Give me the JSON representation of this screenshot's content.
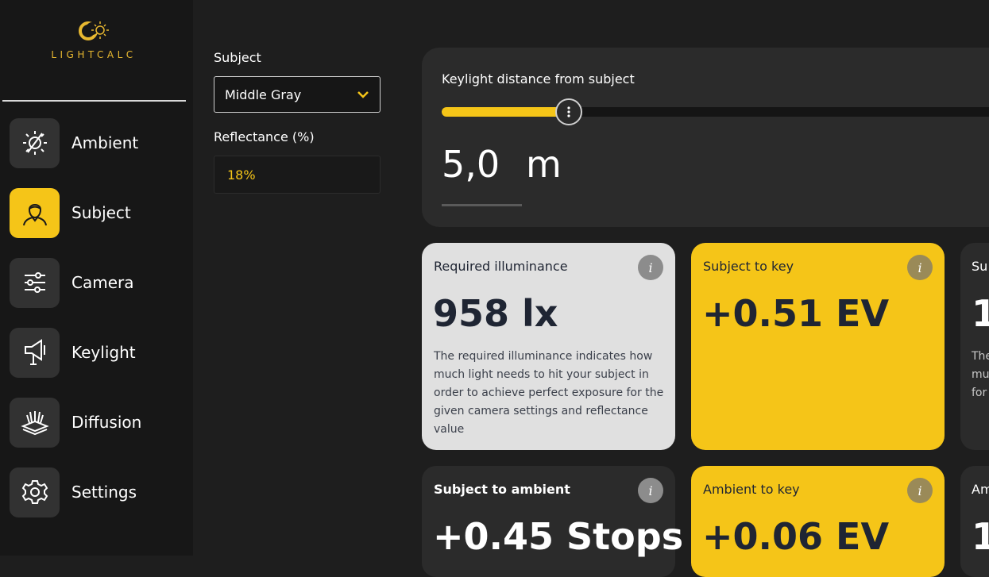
{
  "app": {
    "logo_text": "LIGHTCALC",
    "accent_color": "#f5c518"
  },
  "sidebar": {
    "items": [
      {
        "label": "Ambient",
        "icon": "ambient-sun-slash-icon",
        "active": false
      },
      {
        "label": "Subject",
        "icon": "person-icon",
        "active": true
      },
      {
        "label": "Camera",
        "icon": "sliders-icon",
        "active": false
      },
      {
        "label": "Keylight",
        "icon": "spotlight-icon",
        "active": false
      },
      {
        "label": "Diffusion",
        "icon": "diffusion-icon",
        "active": false
      },
      {
        "label": "Settings",
        "icon": "gear-icon",
        "active": false
      }
    ]
  },
  "subject_panel": {
    "subject_label": "Subject",
    "subject_value": "Middle Gray",
    "reflectance_label": "Reflectance (%)",
    "reflectance_value": "18%"
  },
  "distance": {
    "title": "Keylight distance from subject",
    "value": "5,0",
    "unit": "m",
    "slider_fraction": 0.22
  },
  "cards": [
    {
      "title": "Required illuminance",
      "value": "958 lx",
      "style": "light",
      "description": "The required illuminance indicates how much light needs to hit your subject in order to achieve perfect exposure for the given camera settings and reflectance value"
    },
    {
      "title": "Subject to key",
      "value": "+0.51 EV",
      "style": "yellow"
    },
    {
      "title": "Subject to ambient",
      "value": "+0.45 Stops",
      "style": "dark"
    },
    {
      "title": "Ambient to key",
      "value": "+0.06 EV",
      "style": "yellow"
    }
  ],
  "partial_cards": [
    {
      "title": "Su",
      "value": "1",
      "description_lines": [
        "The",
        "mu",
        "for"
      ]
    },
    {
      "title": "Am",
      "value": "1"
    }
  ],
  "info_glyph": "i"
}
